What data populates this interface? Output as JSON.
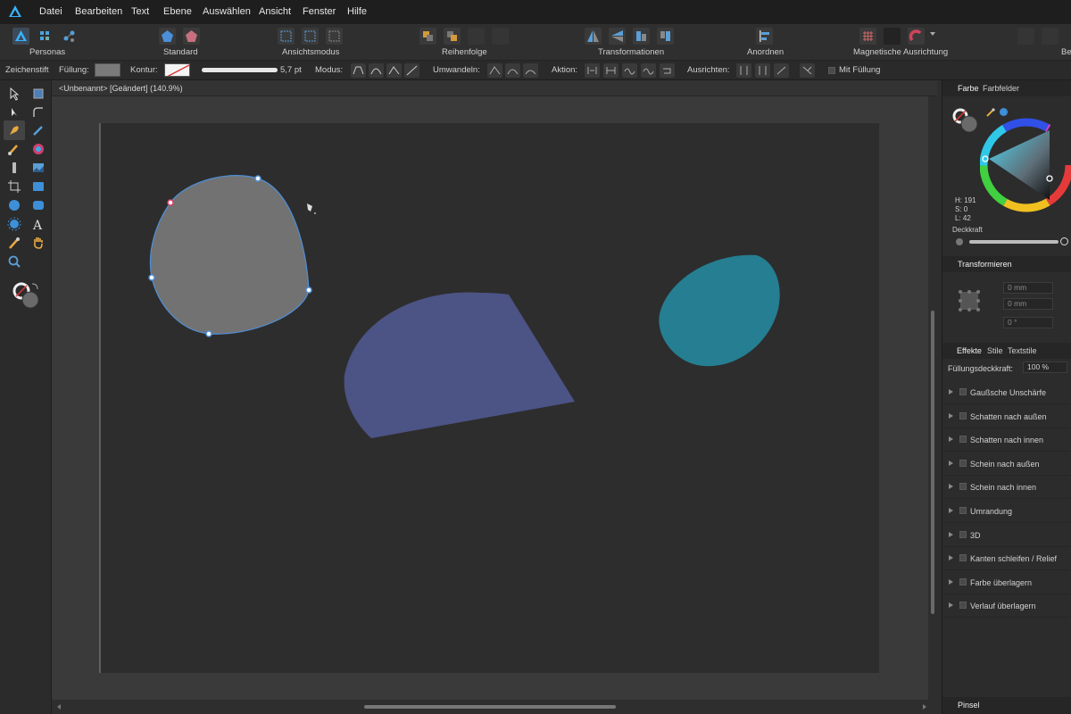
{
  "menu": [
    "Datei",
    "Bearbeiten",
    "Text",
    "Ebene",
    "Auswählen",
    "Ansicht",
    "Fenster",
    "Hilfe"
  ],
  "toolbar": {
    "personas": "Personas",
    "standard": "Standard",
    "ansichtsmodus": "Ansichtsmodus",
    "reihenfolge": "Reihenfolge",
    "transformationen": "Transformationen",
    "anordnen": "Anordnen",
    "magnetisch": "Magnetische Ausrichtung",
    "cut_label": "Be"
  },
  "context": {
    "tool_name": "Zeichenstift",
    "fill_label": "Füllung:",
    "fill_color": "#7a7a7a",
    "stroke_label": "Kontur:",
    "stroke_width": "5,7 pt",
    "mode_label": "Modus:",
    "convert_label": "Umwandeln:",
    "action_label": "Aktion:",
    "align_label": "Ausrichten:",
    "with_fill": "Mit Füllung"
  },
  "document": {
    "title": "<Unbenannt> [Geändert] (140.9%)"
  },
  "shapes": {
    "gray_fill": "#727272",
    "blue_fill": "#4c5385",
    "teal_fill": "#257e91",
    "selection_color": "#4f8fd8"
  },
  "color_panel": {
    "tab_color": "Farbe",
    "tab_swatches": "Farbfelder",
    "h": "H: 191",
    "s": "S: 0",
    "l": "L: 42",
    "opacity_label": "Deckkraft"
  },
  "transform_panel": {
    "title": "Transformieren",
    "x": "0 mm",
    "y": "0 mm",
    "r": "0 °"
  },
  "effects_panel": {
    "tab_effects": "Effekte",
    "tab_styles": "Stile",
    "tab_textstyles": "Textstile",
    "opacity_label": "Füllungsdeckkraft:",
    "opacity_value": "100 %",
    "effects": [
      "Gaußsche Unschärfe",
      "Schatten nach außen",
      "Schatten nach innen",
      "Schein nach außen",
      "Schein nach innen",
      "Umrandung",
      "3D",
      "Kanten schleifen / Relief",
      "Farbe überlagern",
      "Verlauf überlagern"
    ]
  },
  "brush_panel": {
    "title": "Pinsel"
  }
}
